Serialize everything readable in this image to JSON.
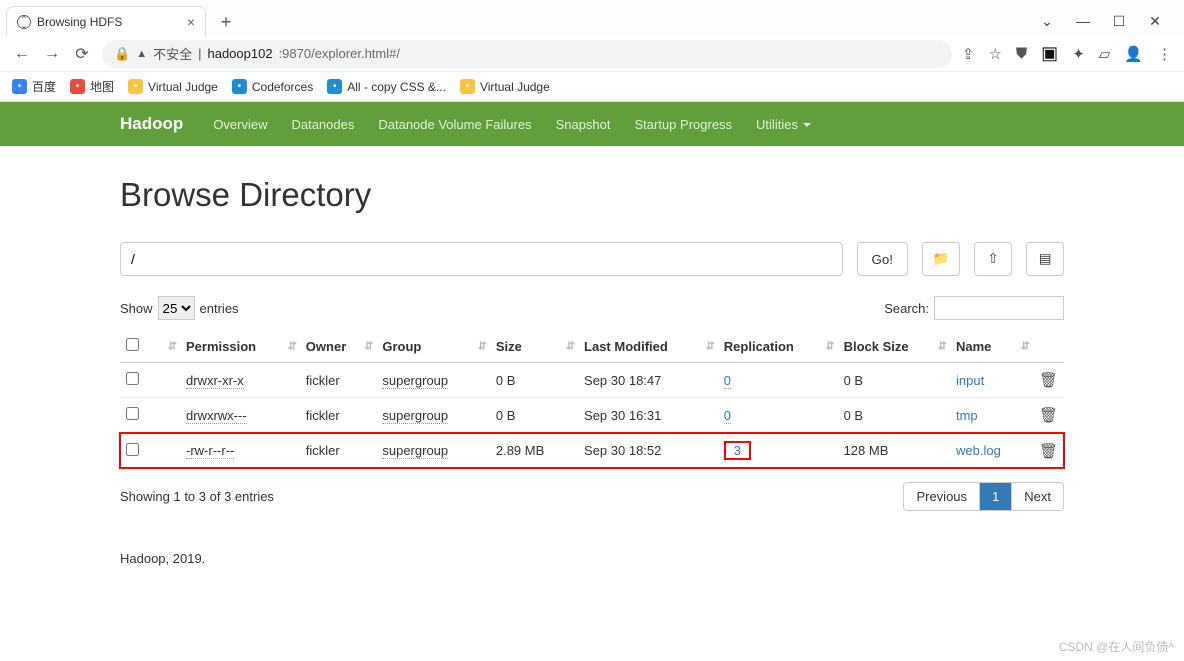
{
  "browser": {
    "tab_title": "Browsing HDFS",
    "url_insecure_label": "不安全",
    "url_host": "hadoop102",
    "url_rest": ":9870/explorer.html#/",
    "bookmarks": [
      {
        "label": "百度",
        "color": "#3385ff"
      },
      {
        "label": "地图",
        "color": "#e74c3c"
      },
      {
        "label": "Virtual Judge",
        "color": "#f5c542"
      },
      {
        "label": "Codeforces",
        "color": "#1f8dd6"
      },
      {
        "label": "All - copy CSS &...",
        "color": "#1f8dd6"
      },
      {
        "label": "Virtual Judge",
        "color": "#f5c542"
      }
    ]
  },
  "nav": {
    "brand": "Hadoop",
    "items": [
      "Overview",
      "Datanodes",
      "Datanode Volume Failures",
      "Snapshot",
      "Startup Progress"
    ],
    "dropdown": "Utilities"
  },
  "page": {
    "heading": "Browse Directory",
    "path_value": "/",
    "go_label": "Go!",
    "show_label": "Show",
    "entries_label": "entries",
    "page_size": "25",
    "search_label": "Search:",
    "columns": [
      "Permission",
      "Owner",
      "Group",
      "Size",
      "Last Modified",
      "Replication",
      "Block Size",
      "Name"
    ],
    "rows": [
      {
        "perm": "drwxr-xr-x",
        "owner": "fickler",
        "group": "supergroup",
        "size": "0 B",
        "mod": "Sep 30 18:47",
        "repl": "0",
        "block": "0 B",
        "name": "input",
        "hl": false
      },
      {
        "perm": "drwxrwx---",
        "owner": "fickler",
        "group": "supergroup",
        "size": "0 B",
        "mod": "Sep 30 16:31",
        "repl": "0",
        "block": "0 B",
        "name": "tmp",
        "hl": false
      },
      {
        "perm": "-rw-r--r--",
        "owner": "fickler",
        "group": "supergroup",
        "size": "2.89 MB",
        "mod": "Sep 30 18:52",
        "repl": "3",
        "block": "128 MB",
        "name": "web.log",
        "hl": true
      }
    ],
    "info_text": "Showing 1 to 3 of 3 entries",
    "prev": "Previous",
    "page_num": "1",
    "next": "Next",
    "footer": "Hadoop, 2019."
  },
  "watermark": "CSDN @在人间负债^"
}
